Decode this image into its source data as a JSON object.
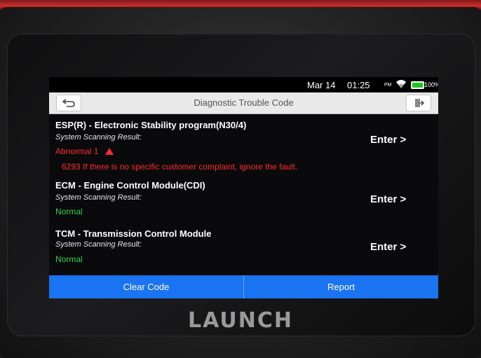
{
  "status_bar": {
    "date": "Mar 14",
    "time": "01:25",
    "ampm": "PM",
    "battery": "100%",
    "icons": [
      "wifi-icon",
      "battery-icon"
    ]
  },
  "header": {
    "title": "Diagnostic Trouble Code",
    "back_icon": "back-arrow-icon",
    "exit_icon": "exit-icon"
  },
  "modules": [
    {
      "name": "ESP(R) - Electronic Stability program(N30/4)",
      "scan_label": "System Scanning Result:",
      "status": "Abnormal 1",
      "status_color": "#ff2a2a",
      "note": "6293 If there is no specific customer complaint, ignore the fault.",
      "enter_label": "Enter >"
    },
    {
      "name": "ECM - Engine Control Module(CDI)",
      "scan_label": "System Scanning Result:",
      "status": "Normal",
      "status_color": "#35d04a",
      "enter_label": "Enter >"
    },
    {
      "name": "TCM - Transmission Control Module",
      "scan_label": "System Scanning Result:",
      "status": "Normal",
      "status_color": "#35d04a",
      "enter_label": "Enter >"
    }
  ],
  "buttons": {
    "clear_code": "Clear Code",
    "report": "Report"
  },
  "brand": "LAUNCH",
  "colors": {
    "accent": "#1a73f0",
    "abnormal": "#ff2a2a",
    "normal": "#35d04a"
  }
}
